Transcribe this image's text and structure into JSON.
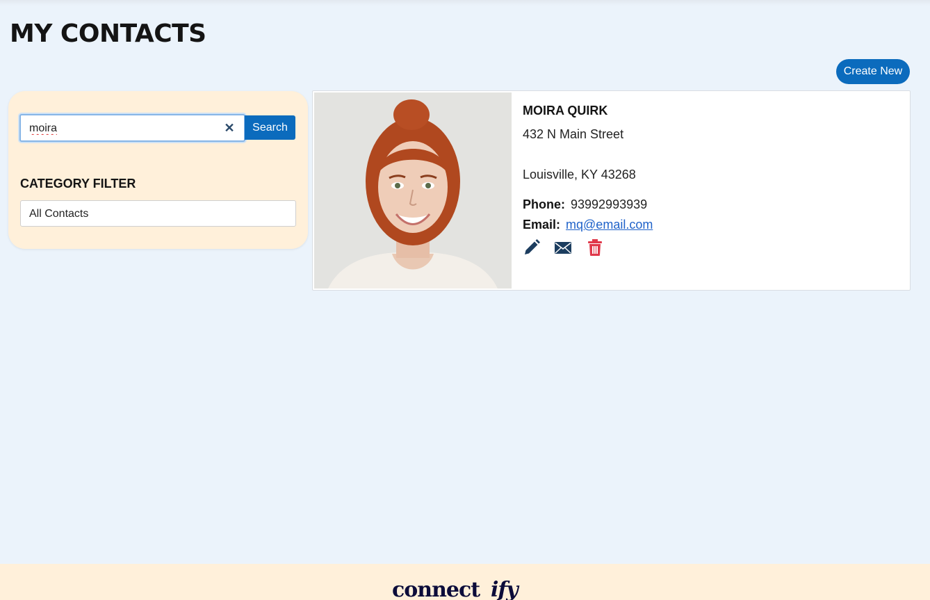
{
  "page": {
    "title": "MY CONTACTS"
  },
  "toolbar": {
    "create_label": "Create New"
  },
  "sidebar": {
    "search": {
      "value": "moira",
      "button_label": "Search"
    },
    "filter": {
      "title": "CATEGORY FILTER",
      "selected": "All Contacts"
    }
  },
  "contact": {
    "name": "MOIRA QUIRK",
    "address_line1": "432 N Main Street",
    "address_line2": "Louisville, KY 43268",
    "phone_label": "Phone:",
    "phone": "93992993939",
    "email_label": "Email:",
    "email": "mq@email.com"
  },
  "icons": {
    "clear": "close-icon",
    "edit": "pencil-icon",
    "email": "envelope-icon",
    "delete": "trash-icon"
  },
  "colors": {
    "accent": "#0b6bbd",
    "page_bg": "#ebf3fb",
    "panel_bg": "#fff0da",
    "delete": "#e0384a",
    "icon_dark": "#1c3d5f",
    "logo": "#0c0c3a"
  },
  "footer": {
    "logo_part1": "connect",
    "logo_part2": "ify"
  }
}
